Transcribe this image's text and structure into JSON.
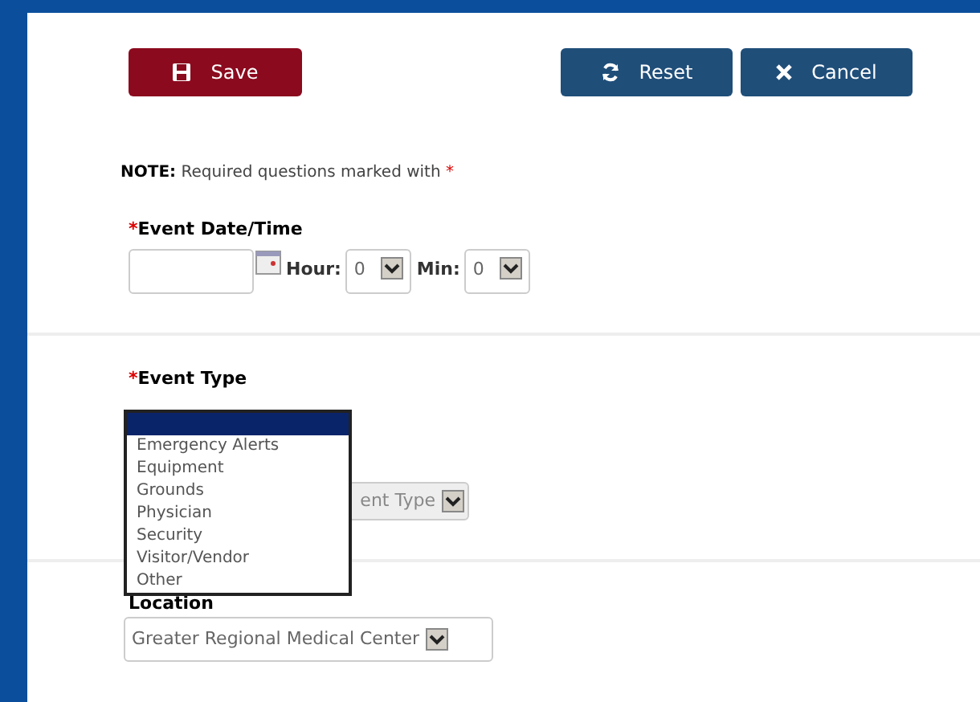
{
  "toolbar": {
    "buttons": [
      {
        "kind": "save",
        "label": "Save"
      },
      {
        "kind": "reset",
        "label": "Reset"
      },
      {
        "kind": "cancel",
        "label": "Cancel"
      }
    ]
  },
  "note": {
    "lead": "NOTE:",
    "text": "Required questions marked with",
    "mark": "*"
  },
  "event_datetime": {
    "required_mark": "*",
    "label": "Event Date/Time",
    "hour_label": "Hour:",
    "hour": "0",
    "min_label": "Min:",
    "min": "0"
  },
  "event_type": {
    "required_mark": "*",
    "label": "Event Type",
    "select_text": "ent Type",
    "open": true,
    "options": [
      {
        "selected": true
      },
      {
        "label": "Emergency Alerts",
        "selected": false
      },
      {
        "label": "Equipment",
        "selected": false
      },
      {
        "label": "Grounds",
        "selected": false
      },
      {
        "label": "Physician",
        "selected": false
      },
      {
        "label": "Security",
        "selected": false
      },
      {
        "label": "Visitor/Vendor",
        "selected": false
      },
      {
        "label": "Other",
        "selected": false
      }
    ]
  },
  "location": {
    "label": "Location",
    "value": "Greater Regional Medical Center"
  }
}
